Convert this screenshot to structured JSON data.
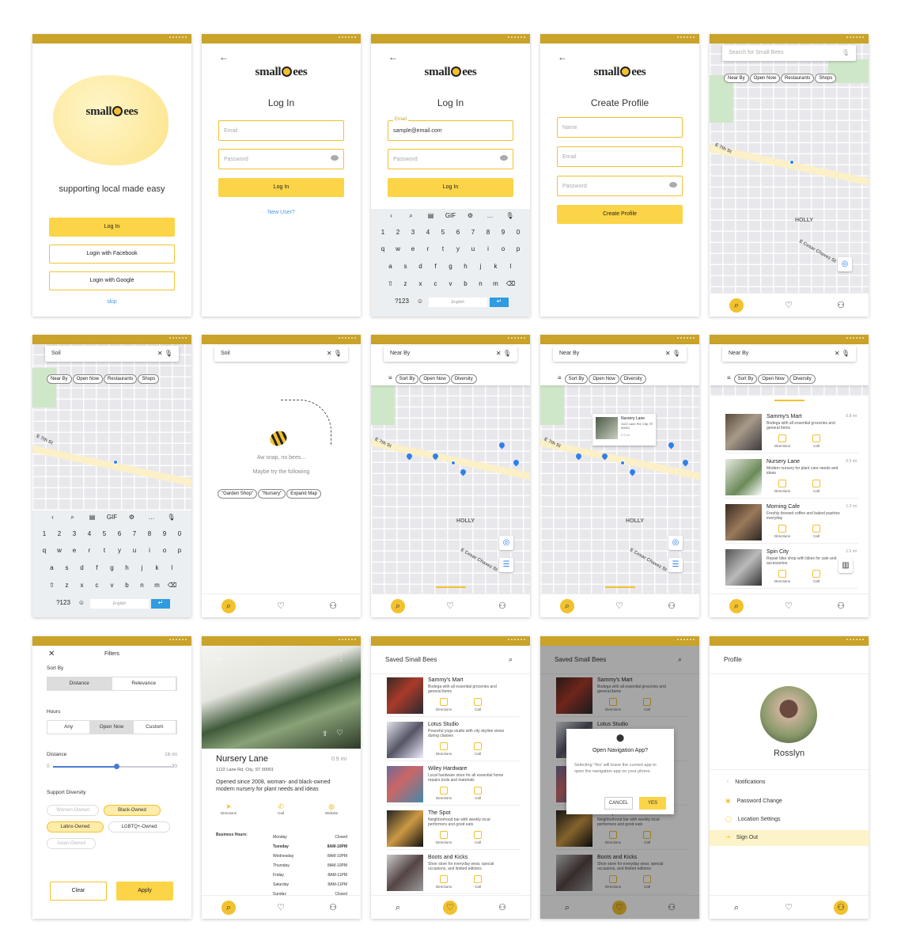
{
  "brand": {
    "logo_left": "small",
    "logo_right": "ees",
    "tagline": "supporting local made easy"
  },
  "welcome": {
    "login": "Log In",
    "facebook": "Login with Facebook",
    "google": "Login with Google",
    "skip": "skip"
  },
  "login": {
    "title": "Log In",
    "email_ph": "Email",
    "password_ph": "Password",
    "button": "Log In",
    "new_user": "New User?",
    "email_label": "Email",
    "email_value": "sample@email.com"
  },
  "keyboard": {
    "r1": [
      "1",
      "2",
      "3",
      "4",
      "5",
      "6",
      "7",
      "8",
      "9",
      "0"
    ],
    "r2": [
      "q",
      "w",
      "e",
      "r",
      "t",
      "y",
      "u",
      "i",
      "o",
      "p"
    ],
    "r3": [
      "a",
      "s",
      "d",
      "f",
      "g",
      "h",
      "j",
      "k",
      "l"
    ],
    "r4": [
      "z",
      "x",
      "c",
      "v",
      "b",
      "n",
      "m"
    ],
    "gif": "GIF",
    "num": "?123",
    "lang": "English"
  },
  "create": {
    "title": "Create Profile",
    "name_ph": "Name",
    "email_ph": "Email",
    "password_ph": "Password",
    "button": "Create Profile"
  },
  "map": {
    "search_ph": "Search for Small Bees",
    "soil": "Soil",
    "near_by": "Near By",
    "chips": [
      "Near By",
      "Open Now",
      "Restaurants",
      "Shops"
    ],
    "sort_chips": [
      "Sort By",
      "Open Now",
      "Diversity"
    ],
    "holly": "HOLLY",
    "street1": "E 7th St",
    "street2": "E Cesar Chavez St"
  },
  "empty": {
    "msg": "Aw snap, no bees...",
    "hint": "Maybe try the following",
    "sugs": [
      "\"Garden Shop\"",
      "\"Nursery\"",
      "Expand Map"
    ]
  },
  "popup": {
    "name": "Nursery Lane",
    "addr": "1122 Lane Rd, City, ST 00001",
    "mi": "0.9 mi"
  },
  "results": [
    {
      "name": "Sammy's Mart",
      "desc": "Bodega with all essential groceries and general items",
      "mi": "0.8 mi"
    },
    {
      "name": "Nursery Lane",
      "desc": "Modern nursery for plant care needs and ideas",
      "mi": "0.9 mi"
    },
    {
      "name": "Morning Cafe",
      "desc": "Freshly brewed coffee and baked pastries everyday",
      "mi": "1.2 mi"
    },
    {
      "name": "Spin City",
      "desc": "Repair bike shop with bikes for sale and accessories",
      "mi": "1.5 mi"
    }
  ],
  "actions": {
    "dir": "Directions",
    "call": "Call",
    "web": "Website"
  },
  "filters": {
    "title": "Filters",
    "sort_by": "Sort By",
    "distance": "Distance",
    "relevance": "Relevance",
    "hours": "Hours",
    "any": "Any",
    "open_now": "Open Now",
    "custom": "Custom",
    "distance_lbl": "Distance",
    "dist_val": "16 mi",
    "min": "0",
    "max": "30",
    "diversity": "Support Diversity",
    "div": [
      "Women-Owned",
      "Black-Owned",
      "Latinx-Owned",
      "LGBTQ+-Owned",
      "Asian-Owned"
    ],
    "clear": "Clear",
    "apply": "Apply"
  },
  "detail": {
    "name": "Nursery Lane",
    "mi": "0.9 mi",
    "addr": "1122 Lane Rd, City, ST 00001",
    "desc": "Opened since 2008, woman- and black-owned modern nursery for plant needs and ideas",
    "hours_lbl": "Business Hours:",
    "hours": [
      [
        "Monday",
        "Closed"
      ],
      [
        "Tuesday",
        "8AM-10PM"
      ],
      [
        "Wednesday",
        "8AM-10PM"
      ],
      [
        "Thursday",
        "8AM-10PM"
      ],
      [
        "Friday",
        "8AM-11PM"
      ],
      [
        "Saturday",
        "8AM-11PM"
      ],
      [
        "Sunday",
        "Closed"
      ]
    ]
  },
  "saved": {
    "title": "Saved Small Bees",
    "items": [
      {
        "name": "Sammy's Mart",
        "desc": "Bodega with all essential groceries and general items"
      },
      {
        "name": "Lotus Studio",
        "desc": "Peaceful yoga studio with city skyline views during classes"
      },
      {
        "name": "Wiley Hardware",
        "desc": "Local hardware store for all essential home repairs tools and materials"
      },
      {
        "name": "The Spot",
        "desc": "Neighborhood bar with weekly local performers and good eats"
      },
      {
        "name": "Boots and Kicks",
        "desc": "Shoe store for everyday wear, special occasions, and limited editions"
      }
    ]
  },
  "dialog": {
    "title": "Open Navigation App?",
    "body": "Selecting 'Yes' will leave the current app to open the navigation app on your phone.",
    "cancel": "CANCEL",
    "yes": "YES"
  },
  "profile": {
    "title": "Profile",
    "name": "Rosslyn",
    "items": [
      "Notifications",
      "Password Change",
      "Location Settings",
      "Sign Out"
    ]
  }
}
